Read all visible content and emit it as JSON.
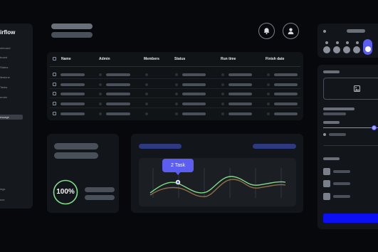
{
  "app": {
    "brand": "irflow",
    "nav": [
      "shboard",
      "board",
      "Status",
      "ilestone",
      "Tasks",
      "ender",
      "essage"
    ],
    "nav_active_index": 6,
    "nav_bottom": [
      "ings",
      "nce"
    ]
  },
  "table": {
    "columns": [
      "Name",
      "Admin",
      "Members",
      "Status",
      "Run time",
      "Finish date"
    ],
    "row_count": 5
  },
  "progress": {
    "value": "100%",
    "percent": 100
  },
  "chart": {
    "tooltip": "2 Task"
  },
  "colors": {
    "accent": "#5b5ef0",
    "primary_button": "#0b0ff2",
    "line_green": "#7fdc86",
    "line_brown": "#8e6e4a",
    "pill_blue": "#2d3a80"
  },
  "icons": {
    "header": [
      "bell-icon",
      "user-icon"
    ],
    "image_placeholder": "image-icon"
  }
}
